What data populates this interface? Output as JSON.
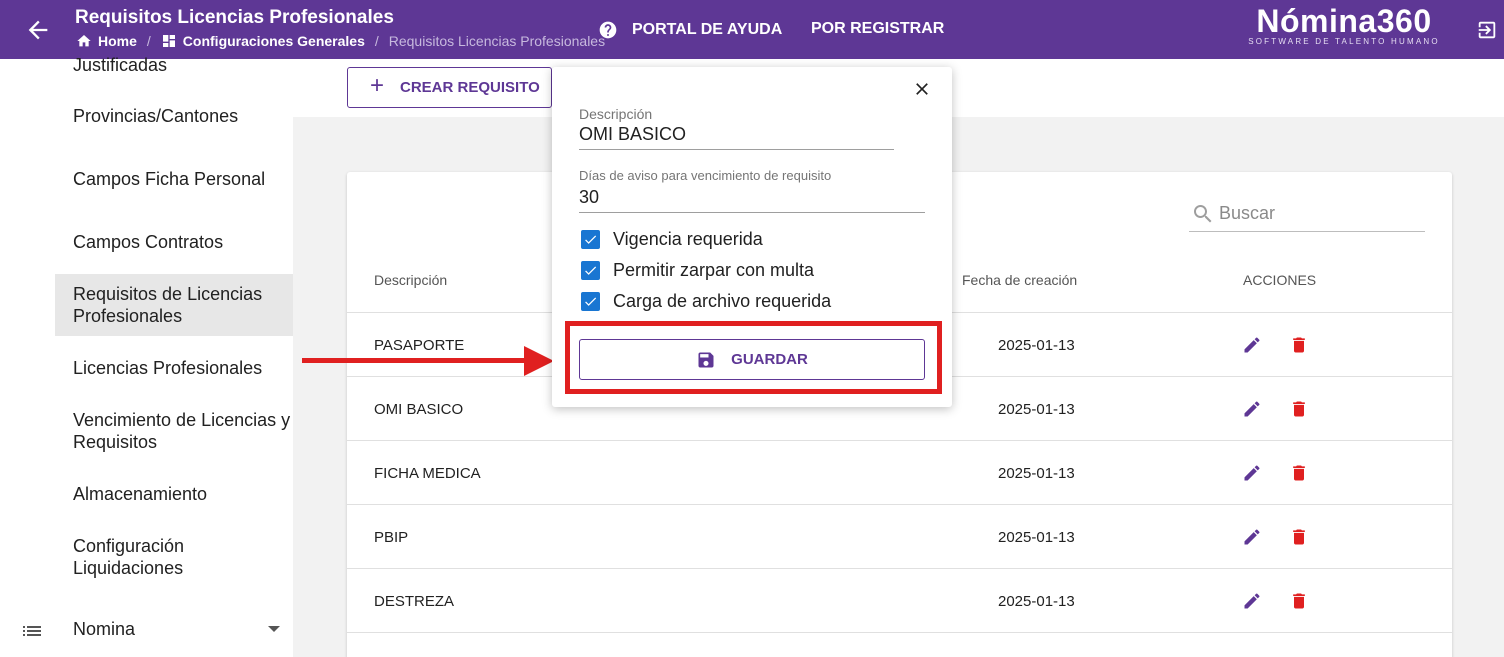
{
  "header": {
    "title": "Requisitos Licencias Profesionales",
    "breadcrumb": [
      {
        "label": "Home",
        "icon": "home-icon"
      },
      {
        "label": "Configuraciones Generales",
        "icon": "dashboard-icon"
      },
      {
        "label": "Requisitos Licencias Profesionales",
        "icon": ""
      }
    ],
    "help_label": "PORTAL DE AYUDA",
    "register_label": "POR REGISTRAR",
    "logo_text": "Nómina360",
    "logo_subtitle": "SOFTWARE DE TALENTO HUMANO",
    "brand_color": "#5e3795"
  },
  "sidebar": {
    "items": [
      {
        "label": "Justificadas"
      },
      {
        "label": "Provincias/Cantones"
      },
      {
        "label": "Campos Ficha Personal"
      },
      {
        "label": "Campos Contratos"
      },
      {
        "label": "Requisitos de Licencias Profesionales",
        "active": true
      },
      {
        "label": "Licencias Profesionales"
      },
      {
        "label": "Vencimiento de Licencias y Requisitos"
      },
      {
        "label": "Almacenamiento"
      },
      {
        "label": "Configuración Liquidaciones"
      }
    ],
    "group_label": "Nomina"
  },
  "toolbar": {
    "create_label": "CREAR REQUISITO"
  },
  "table": {
    "search_placeholder": "Buscar",
    "columns": [
      "Descripción",
      "Fecha de creación",
      "ACCIONES"
    ],
    "rows": [
      {
        "description": "PASAPORTE",
        "date": "2025-01-13"
      },
      {
        "description": "OMI BASICO",
        "date": "2025-01-13"
      },
      {
        "description": "FICHA MEDICA",
        "date": "2025-01-13"
      },
      {
        "description": "PBIP",
        "date": "2025-01-13"
      },
      {
        "description": "DESTREZA",
        "date": "2025-01-13"
      }
    ]
  },
  "popup": {
    "description_label": "Descripción",
    "description_value": "OMI BASICO",
    "days_label": "Días de aviso para vencimiento de requisito",
    "days_value": "30",
    "checkboxes": [
      {
        "label": "Vigencia requerida",
        "checked": true
      },
      {
        "label": "Permitir zarpar con multa",
        "checked": true
      },
      {
        "label": "Carga de archivo requerida",
        "checked": true
      }
    ],
    "save_label": "GUARDAR"
  },
  "colors": {
    "accent": "#5e3795",
    "checkbox": "#1976d2",
    "delete": "#e02020",
    "annotation": "#e02020"
  }
}
